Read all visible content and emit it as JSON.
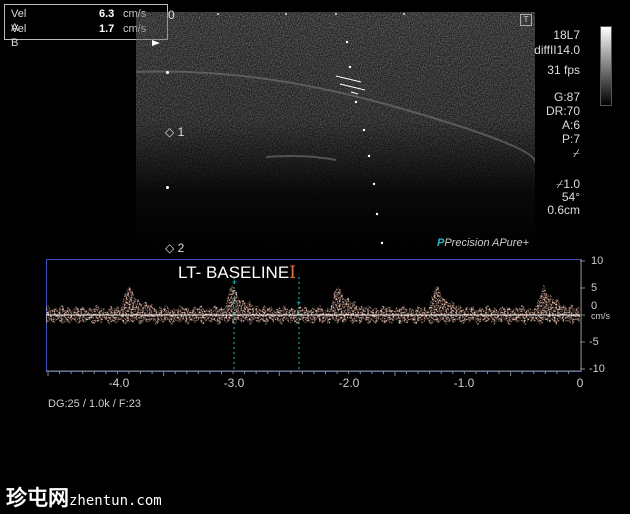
{
  "measurements": [
    {
      "label": "Vel A",
      "value": "6.3",
      "unit": "cm/s"
    },
    {
      "label": "Vel B",
      "value": "1.7",
      "unit": "cm/s"
    }
  ],
  "probe_info": {
    "probe": "18L7",
    "preset": "diffII14.0",
    "frame_rate": "31 fps",
    "gain": "G:87",
    "dynamic_range": "DR:70",
    "a_setting": "A:6",
    "p_setting": "P:7"
  },
  "doppler_info": {
    "angle_correction": "1.0",
    "angle": "54°",
    "gate_depth": "0.6cm"
  },
  "depth_markers": [
    "0",
    "1",
    "2"
  ],
  "features": {
    "precision": "Precision",
    "apure": "APure+"
  },
  "annotation": "LT-  BASELINE",
  "annotation_cursor": "I",
  "velocity_scale": {
    "labels": [
      "10",
      "5",
      "0",
      "cm/s",
      "-5",
      "-10"
    ]
  },
  "time_axis": {
    "labels": [
      "-4.0",
      "-3.0",
      "-2.0",
      "-1.0",
      "0"
    ]
  },
  "footer_params": "DG:25  / 1.0k   / F:23",
  "watermark": {
    "cn": "珍屯网",
    "domain": "zhentun.com"
  },
  "colors": {
    "doppler_border": "#3a4fb8",
    "spectrum": "#e8907a",
    "baseline": "#ffffff",
    "teal": "#29b6c4"
  }
}
